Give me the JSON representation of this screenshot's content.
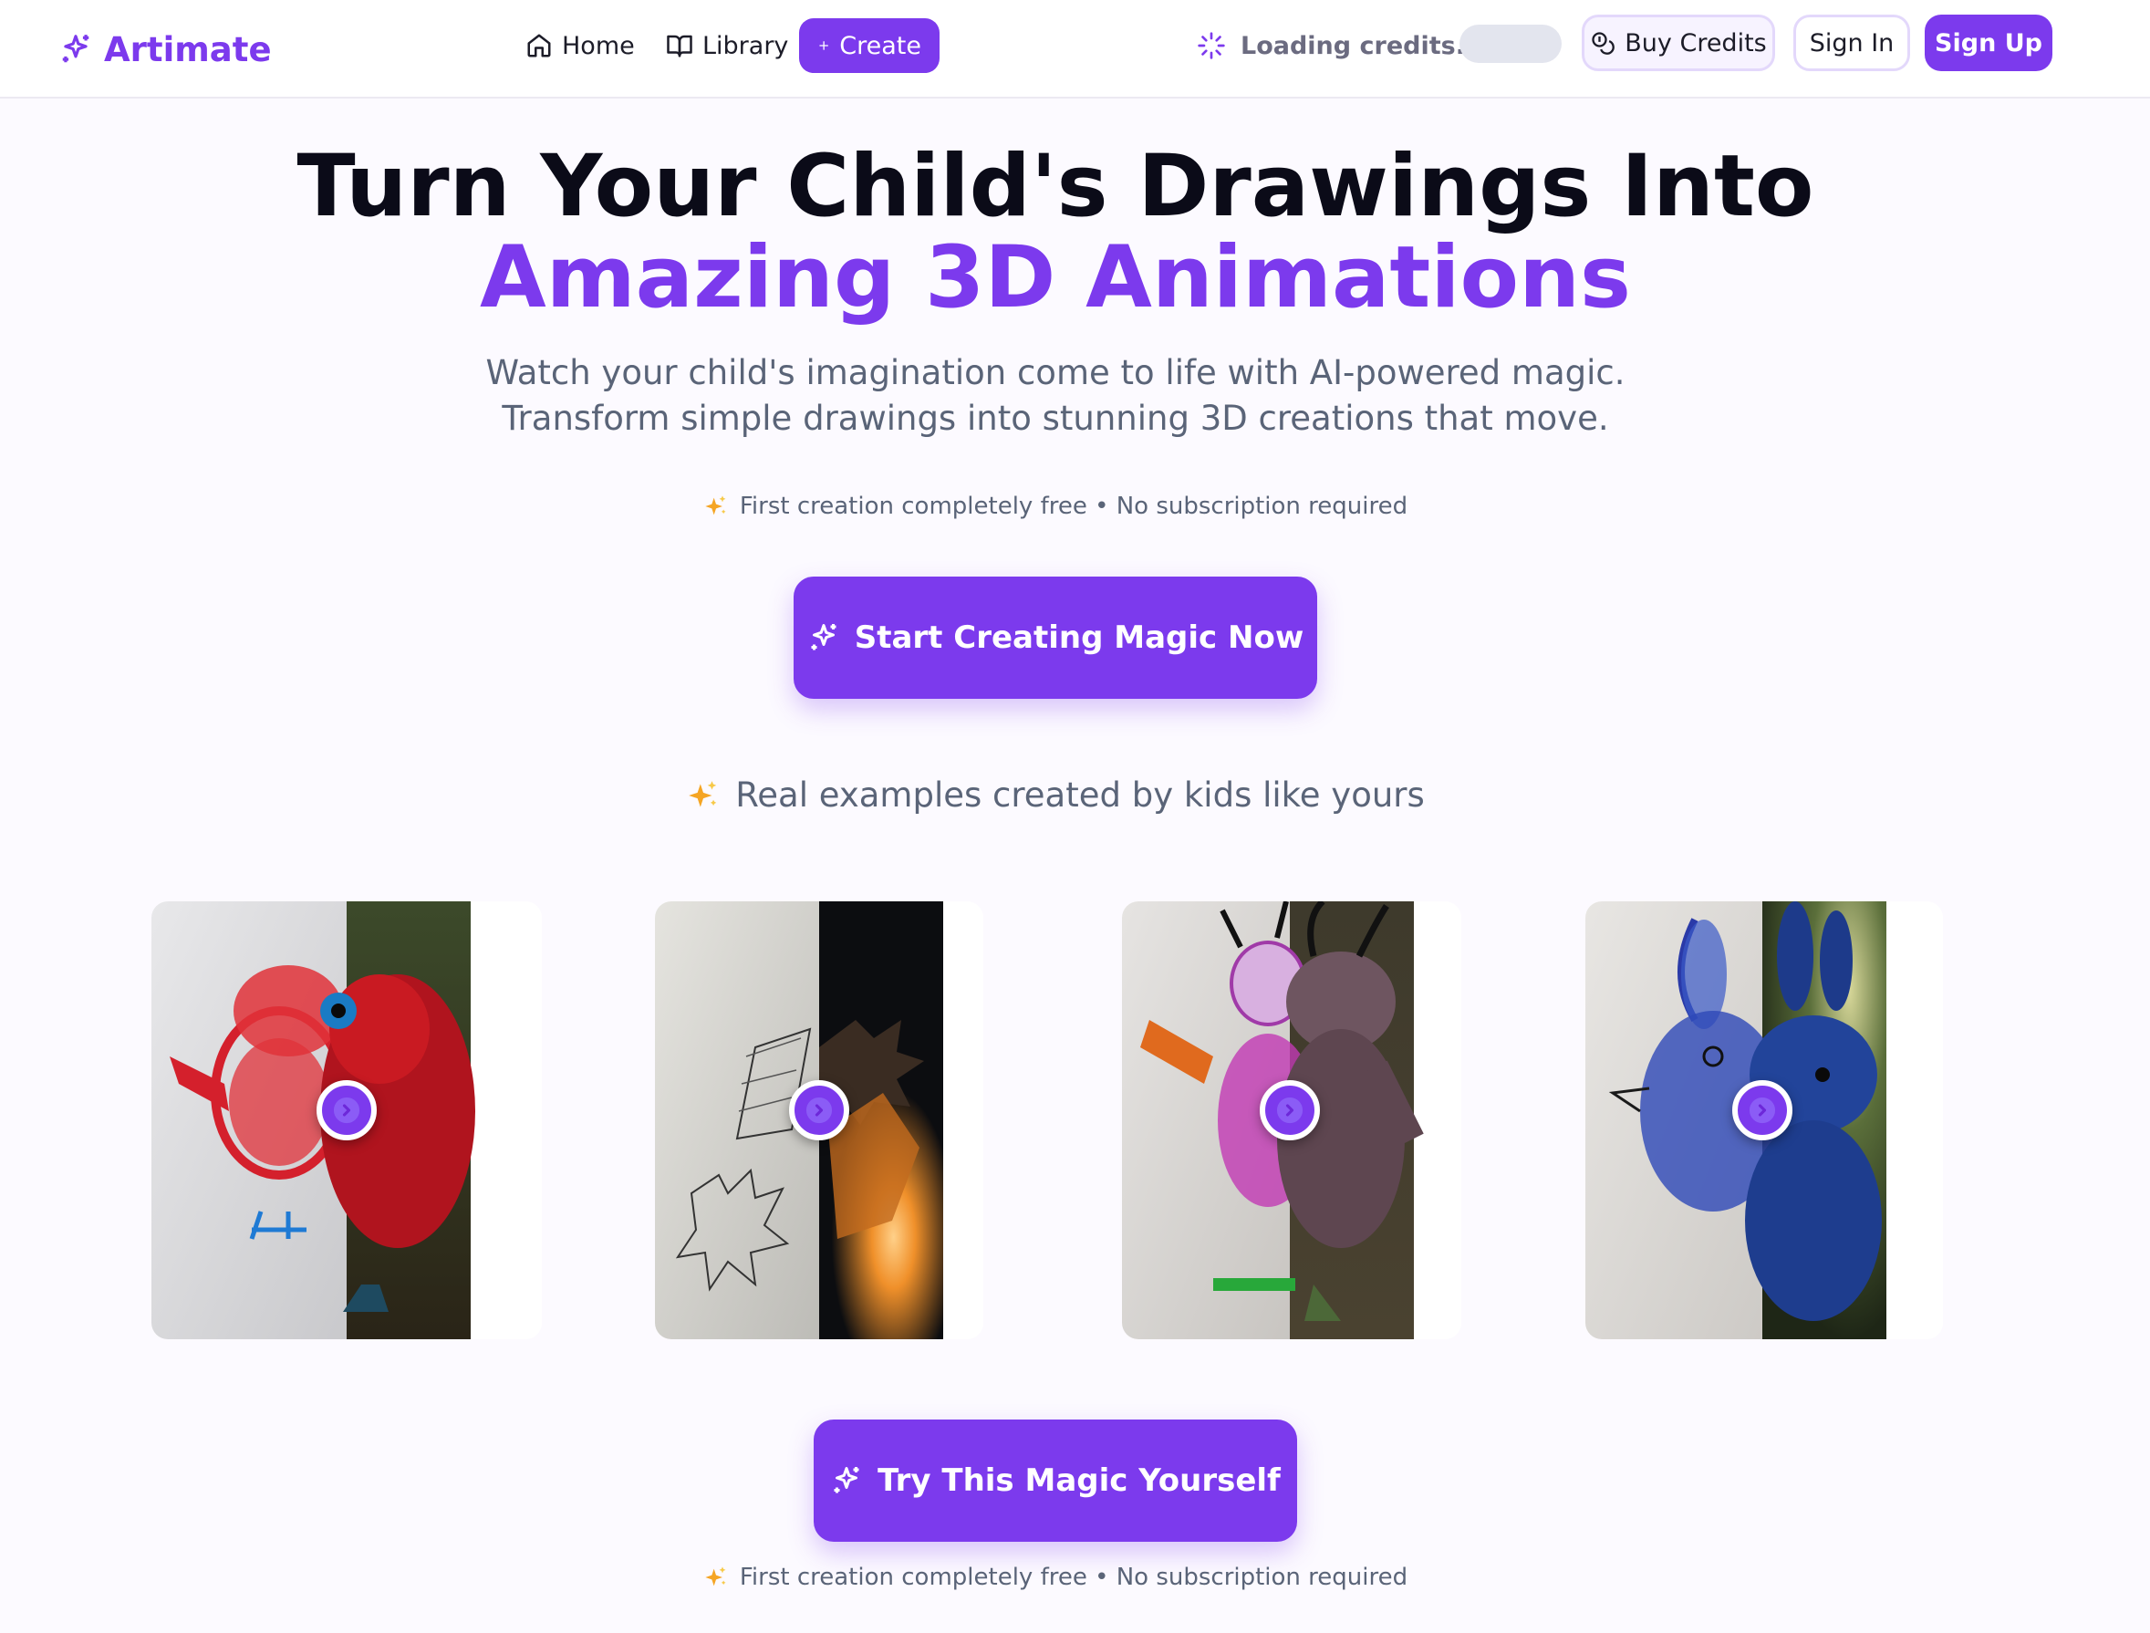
{
  "nav": {
    "brand": "Artimate",
    "home": "Home",
    "library": "Library",
    "create": "Create",
    "loading_credits": "Loading credits...",
    "buy_credits": "Buy Credits",
    "sign_in": "Sign In",
    "sign_up": "Sign Up"
  },
  "hero": {
    "title_line1": "Turn Your Child's Drawings Into",
    "title_line2": "Amazing 3D Animations",
    "subtitle_line1": "Watch your child's imagination come to life with AI-powered magic.",
    "subtitle_line2": "Transform simple drawings into stunning 3D creations that move.",
    "note": "First creation completely free • No subscription required",
    "cta": "Start Creating Magic Now"
  },
  "examples": {
    "heading": "Real examples created by kids like yours",
    "cards": [
      {
        "drawing": "red bird crayon drawing",
        "render": "red furry bird 3D model"
      },
      {
        "drawing": "pencil rocket drawing",
        "render": "glowing rocket 3D render"
      },
      {
        "drawing": "purple bug crayon drawing",
        "render": "felt bug creature 3D model"
      },
      {
        "drawing": "blue bunny crayon drawing",
        "render": "blue plush bunny 3D model"
      }
    ]
  },
  "footer": {
    "cta": "Try This Magic Yourself",
    "note": "First creation completely free • No subscription required"
  },
  "colors": {
    "accent": "#7c3aed",
    "heading": "#0b0b18",
    "muted": "#5a6478",
    "background": "#fcfaff"
  },
  "icons": [
    "sparkles-icon",
    "home-icon",
    "book-icon",
    "plus-icon",
    "loader-icon",
    "coins-icon",
    "chevron-right-icon"
  ]
}
